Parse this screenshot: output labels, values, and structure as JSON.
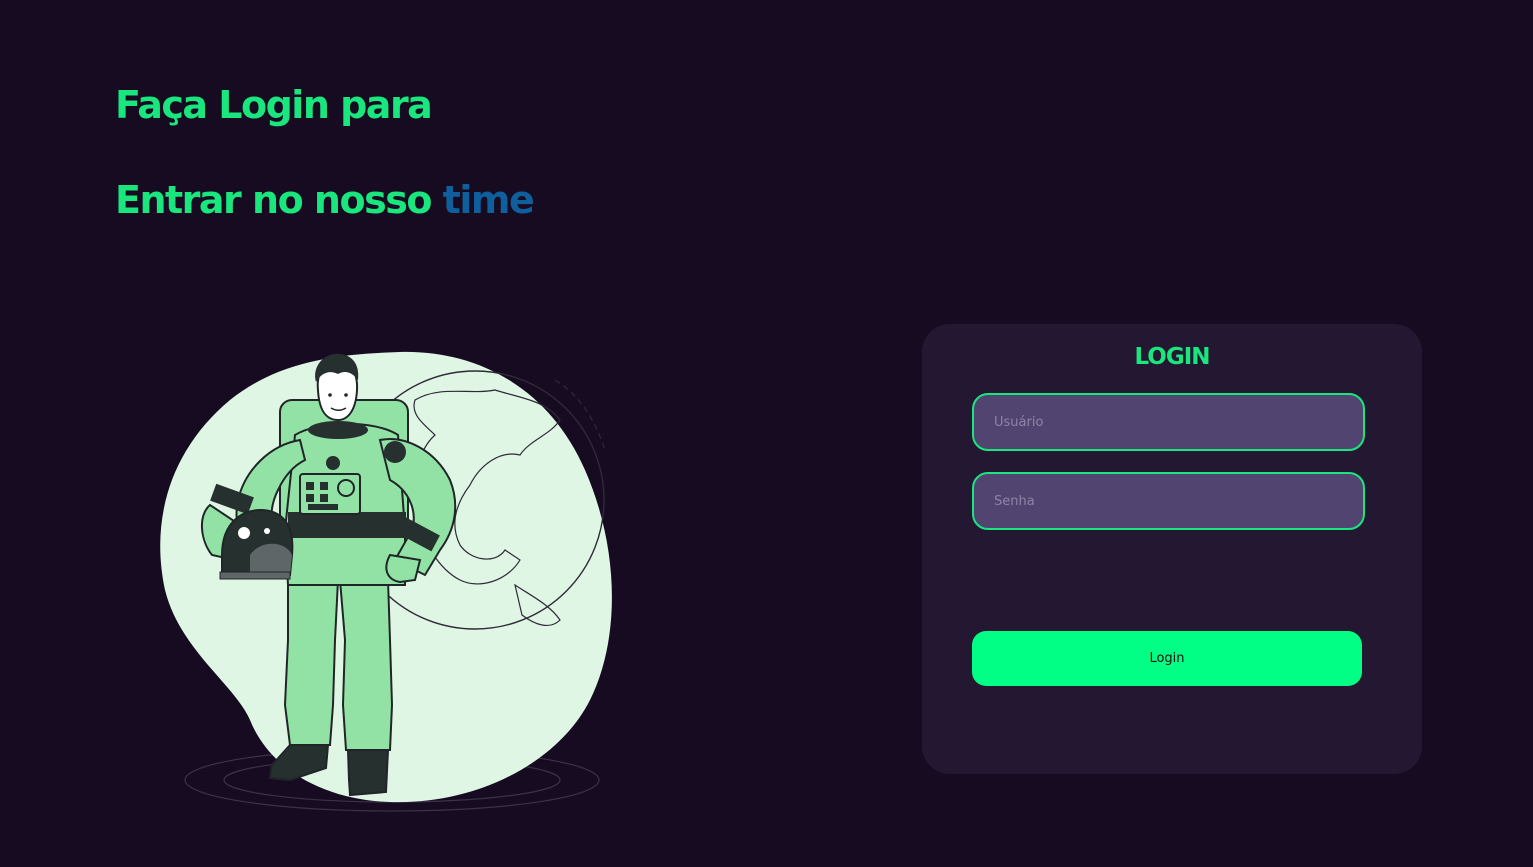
{
  "hero": {
    "line1": "Faça Login para",
    "line2_prefix": "Entrar no nosso ",
    "line2_accent": "time"
  },
  "login": {
    "title": "LOGIN",
    "username_placeholder": "Usuário",
    "password_placeholder": "Senha",
    "button_label": "Login"
  },
  "colors": {
    "background": "#170b22",
    "card": "#241732",
    "accent_green": "#1ae67e",
    "accent_blue": "#0f5f9c",
    "button": "#00ff84",
    "field": "#514470"
  },
  "illustration": {
    "icon": "astronaut-icon"
  }
}
